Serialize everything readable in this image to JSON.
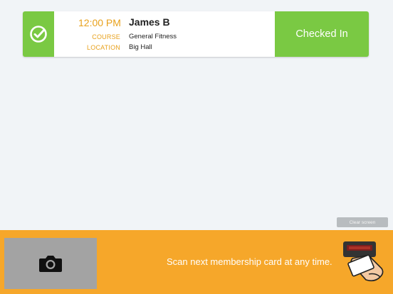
{
  "checkin": {
    "time": "12:00 PM",
    "name": "James B",
    "course_label": "COURSE",
    "course_value": "General Fitness",
    "location_label": "LOCATION",
    "location_value": "Big Hall",
    "status": "Checked In"
  },
  "clear_button_label": "Clear screen",
  "footer": {
    "message": "Scan next membership card at any time."
  },
  "colors": {
    "accent_green": "#7ac943",
    "accent_orange": "#f6a72a",
    "label_orange": "#e8a11c",
    "camera_panel": "#a3a3a3",
    "background": "#f1f4f7"
  },
  "icons": {
    "check": "check-circle-icon",
    "camera": "camera-icon",
    "scanner": "card-scanner-icon"
  }
}
